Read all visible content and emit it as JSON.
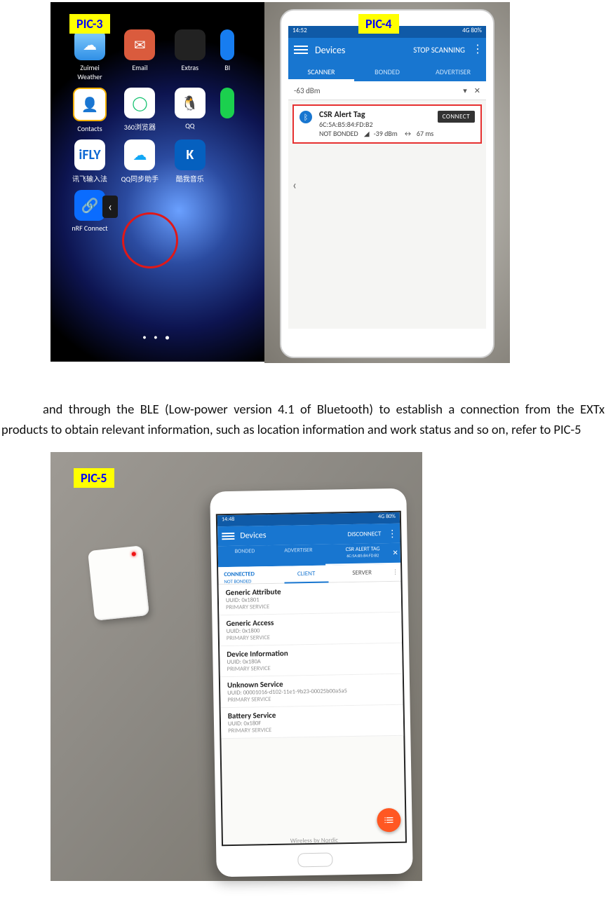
{
  "labels": {
    "pic3": "PIC-3",
    "pic4": "PIC-4",
    "pic5": "PIC-5"
  },
  "paragraph": "and through the BLE (Low-power version 4.1 of Bluetooth) to establish a connection from the EXTx products to obtain relevant information, such as location information and work status and so on, refer to PIC-5",
  "pic3": {
    "apps": [
      {
        "name": "Zuimei Weather"
      },
      {
        "name": "Email"
      },
      {
        "name": "Extras"
      },
      {
        "name": "BI"
      },
      {
        "name": "Contacts"
      },
      {
        "name": "360浏览器"
      },
      {
        "name": "QQ"
      },
      {
        "name": ""
      },
      {
        "name": "讯飞输入法"
      },
      {
        "name": "QQ同步助手"
      },
      {
        "name": "酷我音乐"
      },
      {
        "name": ""
      },
      {
        "name": "nRF Connect"
      }
    ]
  },
  "pic4": {
    "status": {
      "time": "14:52",
      "right": "4G  80%"
    },
    "appbar": {
      "title": "Devices",
      "action": "STOP SCANNING"
    },
    "tabs": [
      "SCANNER",
      "BONDED",
      "ADVERTISER"
    ],
    "filter": {
      "rssi": "-63 dBm"
    },
    "card": {
      "name": "CSR Alert Tag",
      "mac": "6C:5A:B5:84:FD:B2",
      "bonded": "NOT BONDED",
      "rssi": "-39 dBm",
      "interval": "67 ms",
      "connect": "CONNECT"
    }
  },
  "pic5": {
    "status": {
      "time": "14:48",
      "right": "4G  80%"
    },
    "appbar": {
      "title": "Devices",
      "action": "DISCONNECT"
    },
    "tabs": [
      {
        "label": "BONDED"
      },
      {
        "label": "ADVERTISER"
      },
      {
        "label": "CSR ALERT TAG",
        "sub": "6C:5A:B5:84:FD:B2"
      }
    ],
    "subtabs": {
      "conn1": "CONNECTED",
      "conn2": "NOT BONDED",
      "client": "CLIENT",
      "server": "SERVER"
    },
    "services": [
      {
        "name": "Generic Attribute",
        "uuid": "UUID: 0x1801",
        "type": "PRIMARY SERVICE"
      },
      {
        "name": "Generic Access",
        "uuid": "UUID: 0x1800",
        "type": "PRIMARY SERVICE"
      },
      {
        "name": "Device Information",
        "uuid": "UUID: 0x180A",
        "type": "PRIMARY SERVICE"
      },
      {
        "name": "Unknown Service",
        "uuid": "UUID: 00001016-d102-11e1-9b23-00025b00a5a5",
        "type": "PRIMARY SERVICE"
      },
      {
        "name": "Battery Service",
        "uuid": "UUID: 0x180F",
        "type": "PRIMARY SERVICE"
      }
    ],
    "footer": "Wireless by Nordic"
  }
}
